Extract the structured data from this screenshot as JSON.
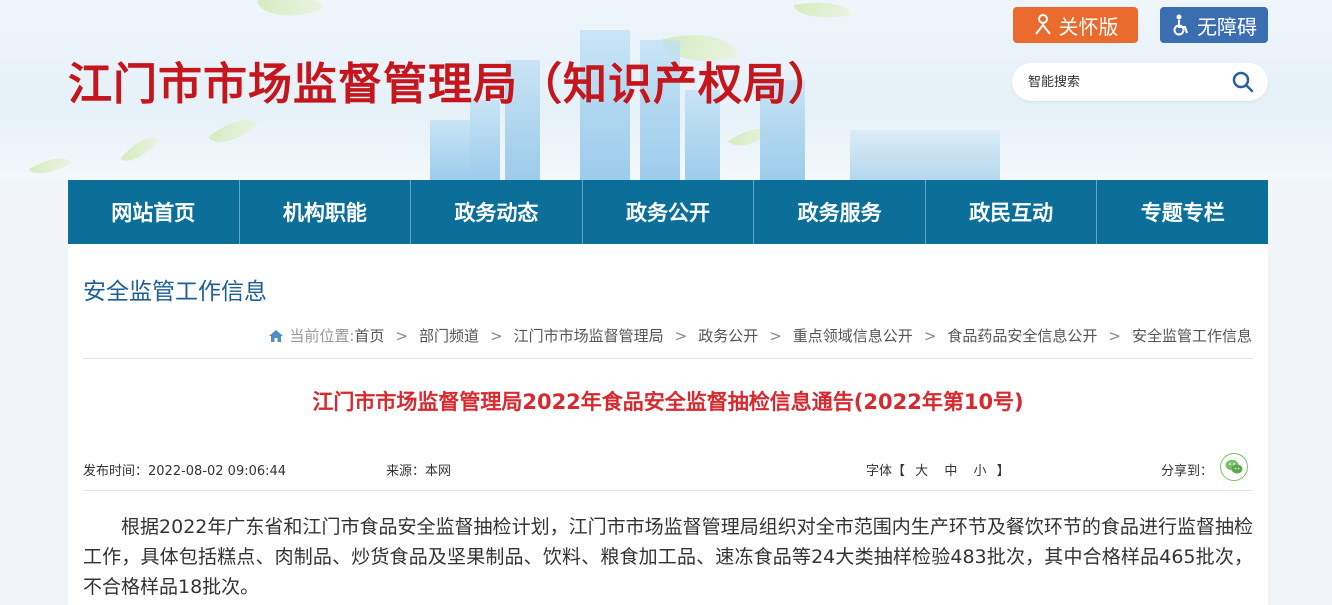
{
  "header": {
    "site_title": "江门市市场监督管理局（知识产权局）",
    "care_label": "关怀版",
    "accessibility_label": "无障碍",
    "search_placeholder": "智能搜索"
  },
  "nav": {
    "items": [
      {
        "label": "网站首页"
      },
      {
        "label": "机构职能"
      },
      {
        "label": "政务动态"
      },
      {
        "label": "政务公开"
      },
      {
        "label": "政务服务"
      },
      {
        "label": "政民互动"
      },
      {
        "label": "专题专栏"
      }
    ]
  },
  "section": {
    "title": "安全监管工作信息"
  },
  "breadcrumb": {
    "prefix": "当前位置:",
    "items": [
      {
        "label": "首页"
      },
      {
        "label": "部门频道"
      },
      {
        "label": "江门市市场监督管理局"
      },
      {
        "label": "政务公开"
      },
      {
        "label": "重点领域信息公开"
      },
      {
        "label": "食品药品安全信息公开"
      },
      {
        "label": "安全监管工作信息"
      }
    ],
    "separator": ">"
  },
  "article": {
    "title": "江门市市场监督管理局2022年食品安全监督抽检信息通告(2022年第10号)",
    "publish_time": "发布时间：2022-08-02 09:06:44",
    "source": "来源：本网",
    "font_label": "字体【",
    "font_large": "大",
    "font_medium": "中",
    "font_small": "小",
    "font_close": "】",
    "share_label": "分享到：",
    "body": "根据2022年广东省和江门市食品安全监督抽检计划，江门市市场监督管理局组织对全市范围内生产环节及餐饮环节的食品进行监督抽检工作，具体包括糕点、肉制品、炒货食品及坚果制品、饮料、粮食加工品、速冻食品等24大类抽样检验483批次，其中合格样品465批次，不合格样品18批次。"
  },
  "colors": {
    "title_red": "#c4161c",
    "nav_blue": "#0b6f9a",
    "care_orange": "#ea6b2d",
    "acc_blue": "#3a6eb0",
    "article_title_red": "#d8292f"
  },
  "icons": {
    "care": "person-heart-icon",
    "accessibility": "wheelchair-icon",
    "search": "search-icon",
    "home": "home-icon",
    "share": "wechat-icon"
  }
}
